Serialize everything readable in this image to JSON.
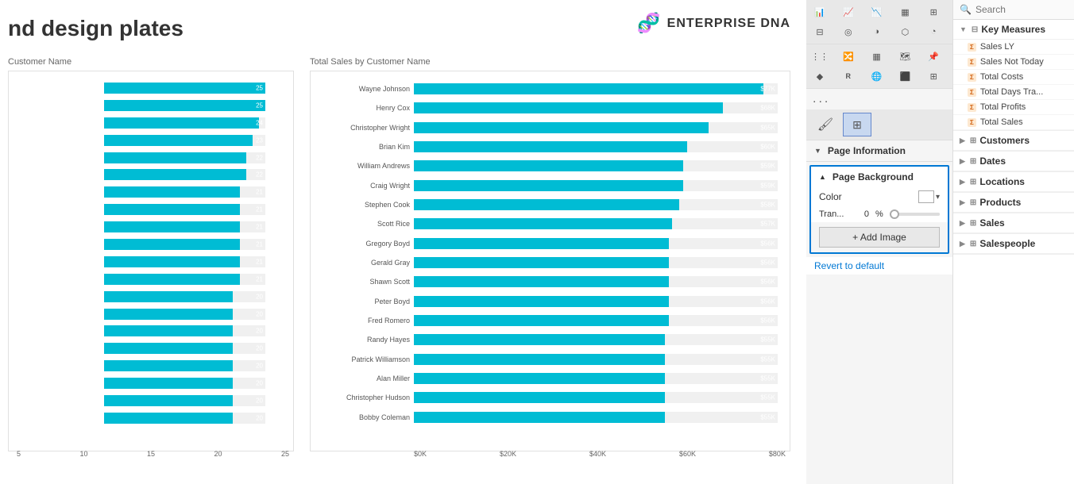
{
  "page": {
    "title": "nd design plates"
  },
  "logo": {
    "text": "ENTERPRISE DNA",
    "icon": "🧬"
  },
  "left_chart": {
    "title": "Customer Name",
    "bars": [
      {
        "label": "",
        "value": 25,
        "max": 25,
        "display": "25"
      },
      {
        "label": "",
        "value": 25,
        "max": 25,
        "display": "25"
      },
      {
        "label": "",
        "value": 24,
        "max": 25,
        "display": "24"
      },
      {
        "label": "",
        "value": 23,
        "max": 25,
        "display": "23"
      },
      {
        "label": "",
        "value": 22,
        "max": 25,
        "display": "22"
      },
      {
        "label": "",
        "value": 22,
        "max": 25,
        "display": "22"
      },
      {
        "label": "",
        "value": 21,
        "max": 25,
        "display": "21"
      },
      {
        "label": "",
        "value": 21,
        "max": 25,
        "display": "21"
      },
      {
        "label": "",
        "value": 21,
        "max": 25,
        "display": "21"
      },
      {
        "label": "",
        "value": 21,
        "max": 25,
        "display": "21"
      },
      {
        "label": "",
        "value": 21,
        "max": 25,
        "display": "21"
      },
      {
        "label": "",
        "value": 21,
        "max": 25,
        "display": "21"
      },
      {
        "label": "",
        "value": 20,
        "max": 25,
        "display": "20"
      },
      {
        "label": "",
        "value": 20,
        "max": 25,
        "display": "20"
      },
      {
        "label": "",
        "value": 20,
        "max": 25,
        "display": "20"
      },
      {
        "label": "",
        "value": 20,
        "max": 25,
        "display": "20"
      },
      {
        "label": "",
        "value": 20,
        "max": 25,
        "display": "20"
      },
      {
        "label": "",
        "value": 20,
        "max": 25,
        "display": "20"
      },
      {
        "label": "",
        "value": 20,
        "max": 25,
        "display": "20"
      },
      {
        "label": "",
        "value": 20,
        "max": 25,
        "display": "20"
      }
    ],
    "x_axis": [
      "5",
      "10",
      "15",
      "20",
      "25"
    ]
  },
  "right_chart": {
    "title": "Total Sales by Customer Name",
    "bars": [
      {
        "label": "Wayne Johnson",
        "value": 96,
        "max": 100,
        "display": "$77K"
      },
      {
        "label": "Henry Cox",
        "value": 85,
        "max": 100,
        "display": "$68K"
      },
      {
        "label": "Christopher Wright",
        "value": 81,
        "max": 100,
        "display": "$65K"
      },
      {
        "label": "Brian Kim",
        "value": 75,
        "max": 100,
        "display": "$60K"
      },
      {
        "label": "William Andrews",
        "value": 74,
        "max": 100,
        "display": "$59K"
      },
      {
        "label": "Craig Wright",
        "value": 74,
        "max": 100,
        "display": "$59K"
      },
      {
        "label": "Stephen Cook",
        "value": 73,
        "max": 100,
        "display": "$58K"
      },
      {
        "label": "Scott Rice",
        "value": 71,
        "max": 100,
        "display": "$57K"
      },
      {
        "label": "Gregory Boyd",
        "value": 70,
        "max": 100,
        "display": "$56K"
      },
      {
        "label": "Gerald Gray",
        "value": 70,
        "max": 100,
        "display": "$56K"
      },
      {
        "label": "Shawn Scott",
        "value": 70,
        "max": 100,
        "display": "$56K"
      },
      {
        "label": "Peter Boyd",
        "value": 70,
        "max": 100,
        "display": "$56K"
      },
      {
        "label": "Fred Romero",
        "value": 70,
        "max": 100,
        "display": "$56K"
      },
      {
        "label": "Randy Hayes",
        "value": 69,
        "max": 100,
        "display": "$55K"
      },
      {
        "label": "Patrick Williamson",
        "value": 69,
        "max": 100,
        "display": "$55K"
      },
      {
        "label": "Alan Miller",
        "value": 69,
        "max": 100,
        "display": "$55K"
      },
      {
        "label": "Christopher Hudson",
        "value": 69,
        "max": 100,
        "display": "$55K"
      },
      {
        "label": "Bobby Coleman",
        "value": 69,
        "max": 100,
        "display": "$55K"
      }
    ],
    "x_axis": [
      "$0K",
      "$20K",
      "$40K",
      "$60K",
      "$80K"
    ]
  },
  "format_panel": {
    "toolbar_row1": [
      "📊",
      "📈",
      "📉",
      "🔢",
      "📋",
      "📅",
      "🔲",
      "💠",
      "🔘",
      "🎯"
    ],
    "toolbar_row2": [
      "📦",
      "🔀",
      "🔍",
      "🗺",
      "📌",
      "🔷",
      "Ⓡ",
      "🌐",
      "⬛",
      "▦"
    ],
    "dots": "...",
    "tabs": [
      {
        "label": "🖌",
        "name": "format-tab",
        "active": false
      },
      {
        "label": "⊞",
        "name": "fields-tab",
        "active": true
      }
    ],
    "page_information": {
      "label": "Page Information",
      "collapsed": false
    },
    "page_background": {
      "label": "Page Background",
      "expanded": true,
      "color_label": "Color",
      "color_value": "#ffffff",
      "transparency_label": "Tran...",
      "transparency_value": "0",
      "transparency_pct": "%",
      "add_image_label": "+ Add Image",
      "revert_label": "Revert to default"
    }
  },
  "fields_panel": {
    "search_placeholder": "Search",
    "groups": [
      {
        "name": "Key Measures",
        "expanded": true,
        "items": [
          {
            "label": "Sales LY",
            "type": "sigma"
          },
          {
            "label": "Sales Not Today",
            "type": "sigma"
          },
          {
            "label": "Total Costs",
            "type": "sigma"
          },
          {
            "label": "Total Days Tra...",
            "type": "sigma"
          },
          {
            "label": "Total Profits",
            "type": "sigma"
          },
          {
            "label": "Total Sales",
            "type": "sigma"
          }
        ]
      },
      {
        "name": "Customers",
        "expanded": false,
        "items": []
      },
      {
        "name": "Dates",
        "expanded": false,
        "items": []
      },
      {
        "name": "Locations",
        "expanded": false,
        "items": []
      },
      {
        "name": "Products",
        "expanded": false,
        "items": []
      },
      {
        "name": "Sales",
        "expanded": false,
        "items": []
      },
      {
        "name": "Salespeople",
        "expanded": false,
        "items": []
      }
    ]
  }
}
